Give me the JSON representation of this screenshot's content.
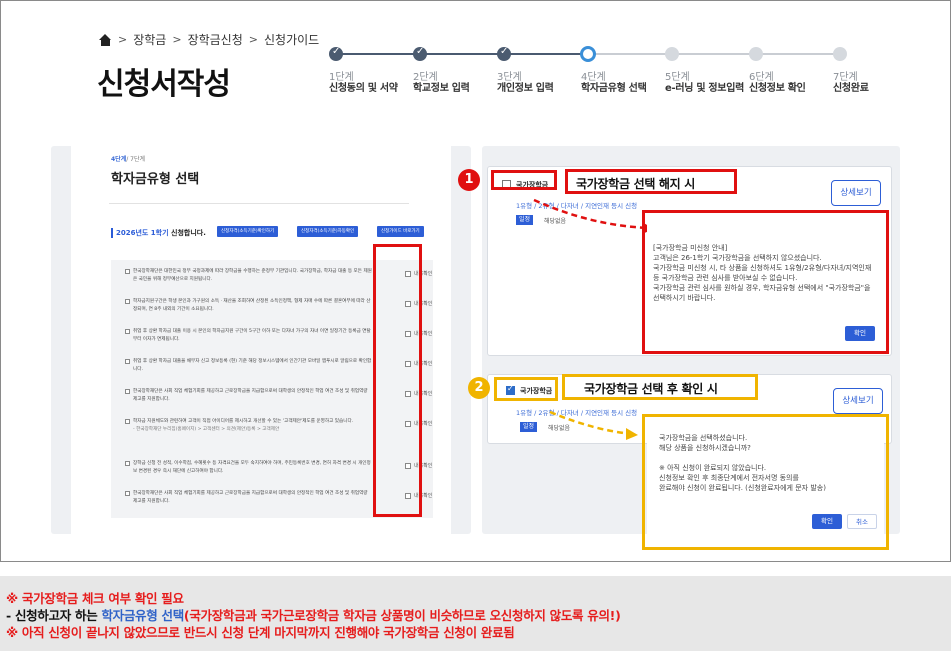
{
  "breadcrumb": {
    "items": [
      "장학금",
      "장학금신청",
      "신청가이드"
    ]
  },
  "page_title": "신청서작성",
  "steps": [
    {
      "num": "1단계",
      "label": "신청동의 및 서약",
      "state": "done"
    },
    {
      "num": "2단계",
      "label": "학교정보 입력",
      "state": "done"
    },
    {
      "num": "3단계",
      "label": "개인정보 입력",
      "state": "done"
    },
    {
      "num": "4단계",
      "label": "학자금유형 선택",
      "state": "current"
    },
    {
      "num": "5단계",
      "label": "e-러닝 및 정보입력",
      "state": "todo"
    },
    {
      "num": "6단계",
      "label": "신청정보 확인",
      "state": "todo"
    },
    {
      "num": "7단계",
      "label": "신청완료",
      "state": "todo"
    }
  ],
  "left": {
    "step_no": "4단계",
    "step_total": "/ 7단계",
    "heading": "학자금유형 선택",
    "semester_year": "2026년도 1학기",
    "semester_suffix": " 신청합니다.",
    "buttons": [
      "신청자격(소득기준)확인하기",
      "신청자격(소득기준)자동확인",
      "신청가이드 바로가기"
    ],
    "confirm_label": "내용확인",
    "items": [
      "한국장학재단은 대한민국 정부 국정과제에 따라 장학금을 수행하는 준정부 기관입니다. 국가장학금, 학자금 대출 등 모든 제원은 국민을 위해 정부예산으로 지원됩니다.",
      "학자금지원구간은 학생 본인과 가구원의 소득ㆍ재산을 조회하여 산정된 소득인정액, 형제 자매 수에 따른 결혼여부에 따라 산정되며, 연 8주 내외의 기간이 소요됩니다.",
      "취업 후 상환 학자금 대출 이용 시 본인의 학자금지원 구간이 5구간 이하 또는 다자녀 가구의 자녀 이면 일정기간 등록금 면탈부터 이자가 면제됩니다.",
      "취업 후 상환 학자금 대출을 채무자 신고 정보등록 (현) 기준 해당 정보시스템에서 인간기관 모바일 앱푸시로 알림으로 확인합니다.",
      "한국장학재단은 사회 직업 체험기회를 제공하고 근로장학금을 지급함으로써 대학생의 안정적인 학업 여건 조성 및 취업역량 제고를 지원합니다.",
      "학자금 지원체도와 관련하여 고객이 직접 아이디어를 제시하고 개선할 수 있는 '고객제안'제도를 운영하고 있습니다.",
      "장학금 신청 전 성적, 이수학점, 수혜횟수 등 자격요건을 모두 숙지하여야 하며, 주민등록번호 변경, 면허 자격 변경 시 개인정보 변경된 경우 즉시 재단에 신고하여야 합니다.",
      "한국장학재단은 사회 직업 체험기회를 제공하고 근로장학금을 지급함으로써 대학생의 안정적인 학업 여건 조성 및 취업역량 제고를 지원합니다."
    ],
    "item_sub": "- 한국장학재단 누리집(홈페이지) > 고객센터 > 의견(제안)등록 > 고객제안"
  },
  "right": {
    "card1": {
      "badge": "1",
      "checkbox_label": "국가장학금",
      "callout": "국가장학금 선택 해지 시",
      "types": "1유형 / 2유형 / 다자녀 / 지연인재 등시 신청",
      "tag": "일정",
      "tag_text": "해당없음",
      "detail_button": "상세보기",
      "popup_text": "[국가장학금 미신청 안내]\n고객님은 26-1학기 국가장학금을 선택하지 않으셨습니다.\n국가장학금 미신청 시, 타 상품을 신청하셔도 1유형/2유형/다자녀/지역인재 등 국가장학금 관련 심사를 받아보실 수 없습니다.\n국가장학금 관련 심사를 원하실 경우, 학자금유형 선택에서 \"국가장학금\"을 선택하시기 바랍니다.",
      "popup_button": "확인"
    },
    "card2": {
      "badge": "2",
      "checkbox_label": "국가장학금",
      "callout": "국가장학금 선택 후 확인 시",
      "types": "1유형 / 2유형 / 다자녀 / 지연인재 등시 신청",
      "tag": "일정",
      "tag_text": "해당없음",
      "detail_button": "상세보기",
      "popup_text": "국가장학금을 선택하셨습니다.\n해당 상품을 신청하시겠습니까?\n\n※ 아직 신청이 완료되지 않았습니다.\n신청정보 확인 후 최종단계에서 전자서명 동의를\n완료해야 신청이 완료됩니다. (신청완료자에게 문자 발송)",
      "ok_button": "확인",
      "cancel_button": "취소"
    }
  },
  "notes": {
    "line1": "※ 국가장학금 체크 여부 확인 필요",
    "line2_prefix": "- 신청하고자 하는 ",
    "line2_blue": "학자금유형 선택",
    "line2_red": "(국가장학금과 국가근로장학금 학자금 상품명이 비슷하므로 오신청하지 않도록 유의!)",
    "line3": "※ 아직 신청이 끝나지 않았으므로 반드시 신청 단계 마지막까지 진행해야 국가장학금 신청이 완료됨"
  },
  "colors": {
    "accent": "#2d5ed6",
    "step_done": "#4b5b70",
    "step_current": "#3a8fd8",
    "highlight_red": "#e01010",
    "highlight_yellow": "#f0b400",
    "note_red": "#e61d1d",
    "note_blue": "#2f62c8"
  }
}
